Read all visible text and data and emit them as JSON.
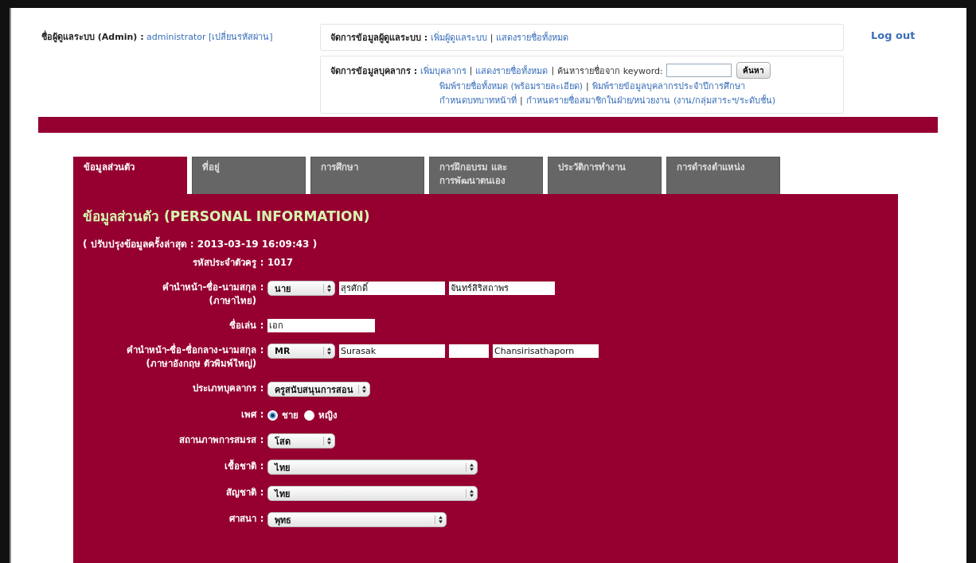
{
  "separator": "|",
  "colon": ":",
  "admin": {
    "label": "ชื่อผู้ดูแลระบบ (Admin) :",
    "user": "administrator",
    "change_password": "[เปลี่ยนรหัสผ่าน]"
  },
  "admin_menu": {
    "label": "จัดการข้อมูลผู้ดูแลระบบ :",
    "links": [
      "เพิ่มผู้ดูแลระบบ",
      "แสดงรายชื่อทั้งหมด"
    ]
  },
  "staff_menu": {
    "label": "จัดการข้อมูลบุคลากร :",
    "links": [
      "เพิ่มบุคลากร",
      "แสดงรายชื่อทั้งหมด"
    ],
    "search_label": "ค้นหารายชื่อจาก keyword:",
    "search_button": "ค้นหา",
    "more_links": [
      [
        "พิมพ์รายชื่อทั้งหมด (พร้อมรายละเอียด)",
        "พิมพ์รายข้อมูลบุคลากรประจำปีการศึกษา"
      ],
      [
        "กำหนดบทบาทหน้าที่",
        "กำหนดรายชื่อสมาชิกในฝ่าย/หน่วยงาน (งาน/กลุ่มสาระฯ/ระดับชั้น)"
      ]
    ]
  },
  "logout": "Log out",
  "tabs": [
    {
      "label": "ข้อมูลส่วนตัว",
      "selected": true
    },
    {
      "label": "ที่อยู่",
      "selected": false
    },
    {
      "label": "การศึกษา",
      "selected": false
    },
    {
      "label": "การฝึกอบรม และ การพัฒนาตนเอง",
      "selected": false
    },
    {
      "label": "ประวัติการทำงาน",
      "selected": false
    },
    {
      "label": "การดำรงตำแหน่ง",
      "selected": false
    }
  ],
  "panel": {
    "title": "ข้อมูลส่วนตัว (PERSONAL INFORMATION)",
    "updated": "( ปรับปรุงข้อมูลครั้งล่าสุด : 2013-03-19 16:09:43 )"
  },
  "fields": [
    {
      "kind": "static",
      "label": "รหัสประจำตัวครู",
      "value": "1017"
    },
    {
      "kind": "name",
      "label": "คำนำหน้า-ชื่อ-นามสกุล",
      "sublabel": "(ภาษาไทย)",
      "parts": [
        {
          "kind": "select",
          "value": "นาย"
        },
        {
          "kind": "input",
          "value": "สุรศักดิ์"
        },
        {
          "kind": "input",
          "value": "จันทร์สิริสถาพร"
        }
      ]
    },
    {
      "kind": "input",
      "label": "ชื่อเล่น",
      "value": "เอก"
    },
    {
      "kind": "name",
      "label": "คำนำหน้า-ชื่อ-ชื่อกลาง-นามสกุล",
      "sublabel": "(ภาษาอังกฤษ ตัวพิมพ์ใหญ่)",
      "parts": [
        {
          "kind": "select",
          "value": "MR"
        },
        {
          "kind": "input",
          "value": "Surasak"
        },
        {
          "kind": "short-input"
        },
        {
          "kind": "input",
          "value": "Chansirisathaporn"
        }
      ]
    },
    {
      "kind": "select",
      "label": "ประเภทบุคลากร",
      "value": "ครูสนับสนุนการสอน"
    },
    {
      "kind": "radio",
      "label": "เพศ",
      "options": [
        {
          "label": "ชาย",
          "selected": true
        },
        {
          "label": "หญิง",
          "selected": false
        }
      ]
    },
    {
      "kind": "select",
      "label": "สถานภาพการสมรส",
      "value": "โสด"
    },
    {
      "kind": "wide-select",
      "label": "เชื้อชาติ",
      "value": "ไทย"
    },
    {
      "kind": "wide-select",
      "label": "สัญชาติ",
      "value": "ไทย"
    },
    {
      "kind": "medium-select",
      "label": "ศาสนา",
      "value": "พุทธ"
    }
  ]
}
